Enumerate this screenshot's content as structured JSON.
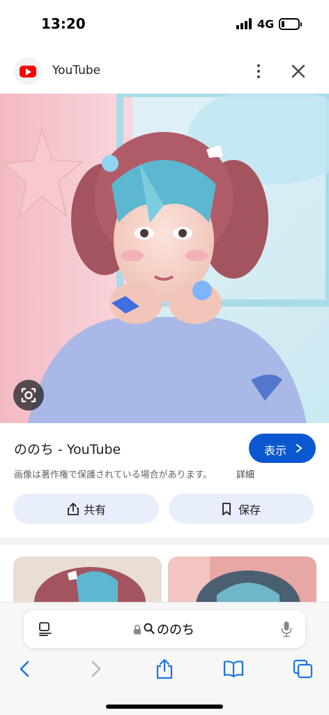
{
  "status_bar": {
    "time": "13:20",
    "network": "4G",
    "battery_level": 0.2
  },
  "header": {
    "site_name": "YouTube",
    "icons": [
      "youtube-logo",
      "more-vertical-icon",
      "close-icon"
    ]
  },
  "image": {
    "lens_icon": "google-lens-icon"
  },
  "result": {
    "title": "ののち - YouTube",
    "visit_label": "表示",
    "copyright_note": "画像は著作権で保護されている場合があります。",
    "details_label": "詳細"
  },
  "actions": {
    "share_label": "共有",
    "save_label": "保存"
  },
  "browser": {
    "address_text": "ののち",
    "icons": [
      "reader-icon",
      "lock-icon",
      "search-icon",
      "mic-icon",
      "back-icon",
      "forward-icon",
      "share-icon",
      "bookmarks-icon",
      "tabs-icon"
    ]
  },
  "colors": {
    "accent": "#0b57d0",
    "chip_bg": "#e8eefb",
    "safari_blue": "#1a73e8",
    "youtube_red": "#ff0000"
  }
}
